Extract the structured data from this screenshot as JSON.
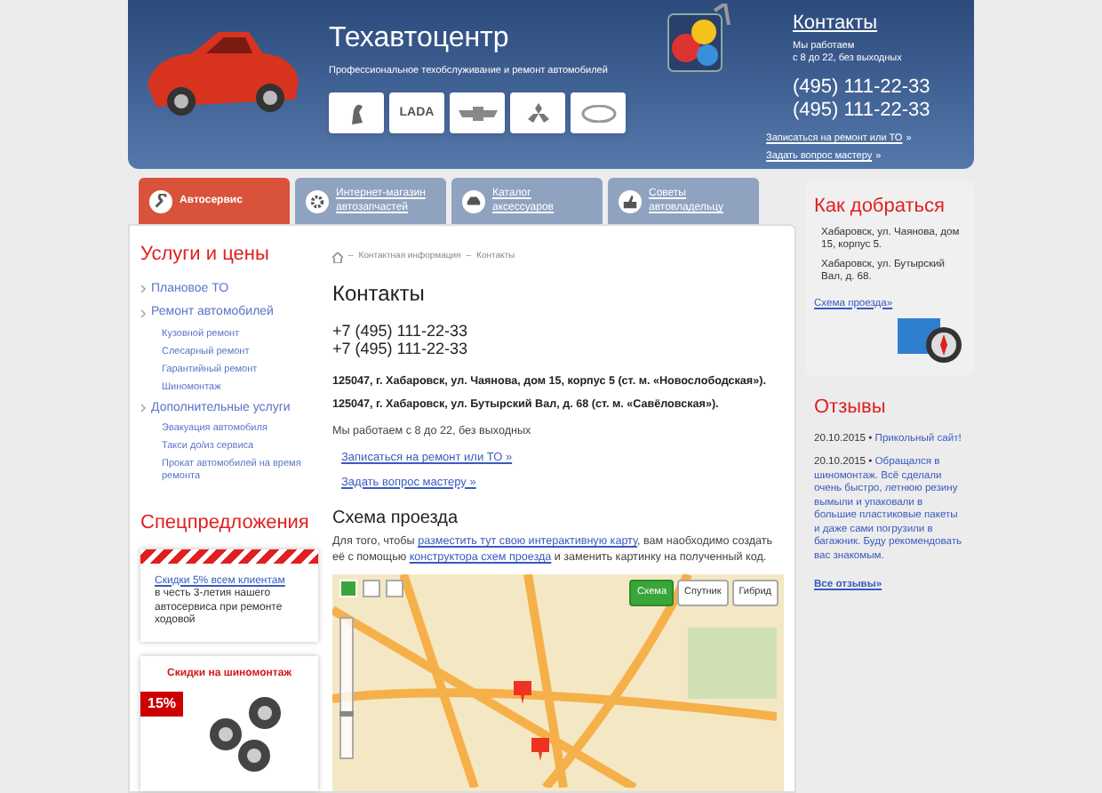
{
  "header": {
    "title": "Техавтоцентр",
    "subtitle": "Профессиональное техобслуживание и ремонт автомобилей",
    "brand_logos": [
      {
        "kind": "emblem"
      },
      {
        "kind": "text",
        "label": "LADA"
      },
      {
        "kind": "bowtie"
      },
      {
        "kind": "diamonds"
      },
      {
        "kind": "oval"
      }
    ],
    "contacts_link": "Контакты",
    "hours": "Мы работаем\nс 8 до 22, без выходных",
    "phones": [
      "(495) 111-22-33",
      "(495) 111-22-33"
    ],
    "links": [
      "Записаться на ремонт или ТО",
      "Задать вопрос мастеру"
    ],
    "link_suffix": "»"
  },
  "tabs": [
    {
      "label": "Автосервис",
      "selected": true,
      "kind": "wrench"
    },
    {
      "label": "Интернет-магазин автозапчастей",
      "selected": false,
      "kind": "gear"
    },
    {
      "label": "Каталог аксессуаров",
      "selected": false,
      "kind": "car"
    },
    {
      "label": "Советы автовладельцу",
      "selected": false,
      "kind": "thumb"
    }
  ],
  "sidebar": {
    "title": "Услуги и цены",
    "items": [
      {
        "label": "Плановое ТО"
      },
      {
        "label": "Ремонт автомобилей",
        "children": [
          {
            "label": "Кузовной ремонт"
          },
          {
            "label": "Слесарный ремонт"
          },
          {
            "label": "Гарантийный ремонт"
          },
          {
            "label": "Шиномонтаж"
          }
        ]
      },
      {
        "label": "Дополнительные услуги",
        "children": [
          {
            "label": "Эвакуация автомобиля"
          },
          {
            "label": "Такси до/из сервиса"
          },
          {
            "label": "Прокат автомобилей на время ремонта"
          }
        ]
      }
    ],
    "offers_title": "Спецпредложения",
    "offer": {
      "link": "Скидки 5% всем клиентам",
      "text": "в честь 3-летия нашего автосервиса при ремонте ходовой"
    },
    "promo": {
      "title": "Скидки на шиномонтаж",
      "badge": "15%"
    }
  },
  "content": {
    "breadcrumbs": [
      "Контактная информация",
      "Контакты"
    ],
    "breadcrumb_separator": "–",
    "title": "Контакты",
    "phones": [
      "+7 (495) 111-22-33",
      "+7 (495) 111-22-33"
    ],
    "addresses": [
      "125047, г. Хабаровск, ул. Чаянова, дом 15, корпус 5 (ст. м. «Новослободская»).",
      "125047, г. Хабаровск, ул. Бутырский Вал, д. 68 (ст. м. «Савёловская»)."
    ],
    "hours": "Мы работаем с 8 до 22, без выходных",
    "links": [
      "Записаться на ремонт или ТО »",
      "Задать вопрос мастеру »"
    ],
    "map_title": "Схема проезда",
    "map_text": [
      {
        "kind": "text",
        "text": "Для того, чтобы "
      },
      {
        "kind": "link",
        "text": "разместить тут свою интерактивную карту"
      },
      {
        "kind": "text",
        "text": ", вам наобходимо создать её с помощью "
      },
      {
        "kind": "link",
        "text": "конструктора схем проезда"
      },
      {
        "kind": "text",
        "text": " и заменить картинку на полученный код."
      }
    ],
    "zoom_slider": {
      "level": 0.3
    },
    "map_modes": [
      {
        "label": "Схема",
        "selected": true
      },
      {
        "label": "Спутник",
        "selected": false
      },
      {
        "label": "Гибрид",
        "selected": false
      }
    ]
  },
  "right": {
    "title": "Как добраться",
    "addresses": [
      "Хабаровск, ул. Чаянова, дом 15, корпус 5.",
      "Хабаровск, ул. Бутырский Вал, д. 68."
    ],
    "scheme_link": "Схема проезда»",
    "reviews_title": "Отзывы",
    "reviews": [
      {
        "date": "20.10.2015",
        "text": "Прикольный сайт!"
      },
      {
        "date": "20.10.2015",
        "text": "Обращался в шиномонтаж. Всё сделали очень быстро, летнюю резину вымыли и упаковали в большие пластиковые пакеты и даже сами погрузили в багажник. Буду рекомендовать вас знакомым."
      }
    ],
    "reviews_separator": "•",
    "all_reviews": "Все отзывы»"
  }
}
